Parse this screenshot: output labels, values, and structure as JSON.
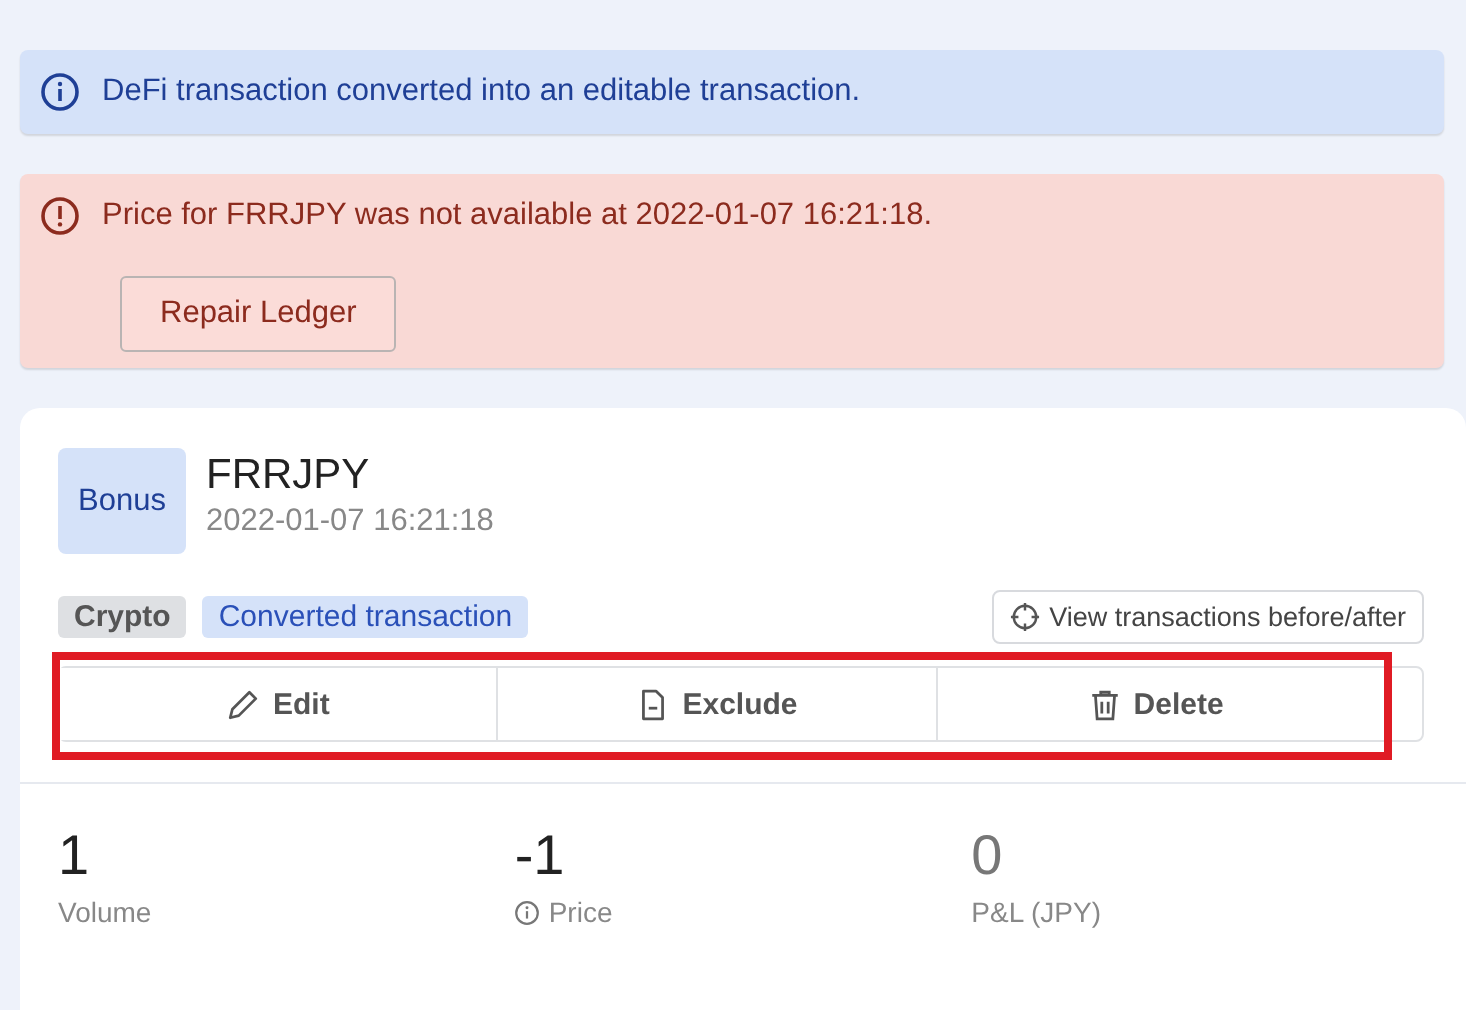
{
  "alerts": [
    {
      "kind": "info",
      "text": "DeFi transaction converted into an editable transaction."
    },
    {
      "kind": "error",
      "text": "Price for FRRJPY was not available at 2022-01-07 16:21:18.",
      "button": "Repair Ledger"
    }
  ],
  "transaction": {
    "type_badge": "Bonus",
    "title": "FRRJPY",
    "timestamp": "2022-01-07 16:21:18",
    "tags": [
      {
        "label": "Crypto",
        "kind": "neutral"
      },
      {
        "label": "Converted transaction",
        "kind": "accent"
      }
    ],
    "view_button": "View transactions before/after",
    "actions_highlighted": true,
    "actions": [
      {
        "label": "Edit",
        "kind": "edit"
      },
      {
        "label": "Exclude",
        "kind": "exclude"
      },
      {
        "label": "Delete",
        "kind": "delete"
      }
    ],
    "stats": [
      {
        "value": "1",
        "label": "Volume",
        "info": false,
        "muted": false
      },
      {
        "value": "-1",
        "label": "Price",
        "info": true,
        "muted": false
      },
      {
        "value": "0",
        "label": "P&L (JPY)",
        "info": false,
        "muted": true
      }
    ]
  }
}
